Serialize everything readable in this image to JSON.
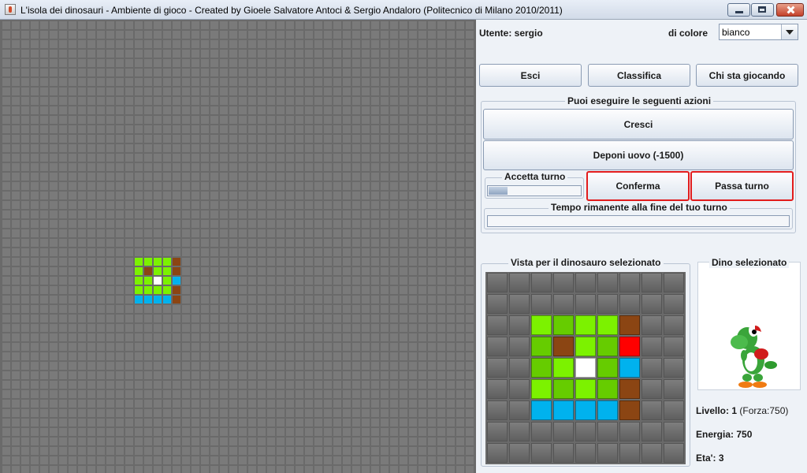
{
  "window": {
    "title": "L'isola dei dinosauri - Ambiente di gioco - Created by Gioele Salvatore Antoci & Sergio Andaloro (Politecnico di Milano 2010/2011)"
  },
  "colors": {
    "map_bg": "#6a6a6a",
    "cell_gray": "#7a7a7a",
    "green": "#7cf200",
    "green_dark": "#66cc00",
    "brown": "#8b4513",
    "cyan": "#00b2ee",
    "white": "#ffffff",
    "red": "#ff0000"
  },
  "map": {
    "cols": 50,
    "rows": 48,
    "colored_cells": [
      {
        "c": 14,
        "r": 25,
        "t": "green"
      },
      {
        "c": 15,
        "r": 25,
        "t": "green"
      },
      {
        "c": 16,
        "r": 25,
        "t": "green"
      },
      {
        "c": 17,
        "r": 25,
        "t": "green"
      },
      {
        "c": 18,
        "r": 25,
        "t": "brown"
      },
      {
        "c": 14,
        "r": 26,
        "t": "green"
      },
      {
        "c": 15,
        "r": 26,
        "t": "brown"
      },
      {
        "c": 16,
        "r": 26,
        "t": "green"
      },
      {
        "c": 17,
        "r": 26,
        "t": "green"
      },
      {
        "c": 18,
        "r": 26,
        "t": "brown"
      },
      {
        "c": 14,
        "r": 27,
        "t": "green"
      },
      {
        "c": 15,
        "r": 27,
        "t": "green"
      },
      {
        "c": 16,
        "r": 27,
        "t": "white"
      },
      {
        "c": 17,
        "r": 27,
        "t": "green"
      },
      {
        "c": 18,
        "r": 27,
        "t": "cyan"
      },
      {
        "c": 14,
        "r": 28,
        "t": "green"
      },
      {
        "c": 15,
        "r": 28,
        "t": "green"
      },
      {
        "c": 16,
        "r": 28,
        "t": "green"
      },
      {
        "c": 17,
        "r": 28,
        "t": "green"
      },
      {
        "c": 18,
        "r": 28,
        "t": "brown"
      },
      {
        "c": 14,
        "r": 29,
        "t": "cyan"
      },
      {
        "c": 15,
        "r": 29,
        "t": "cyan"
      },
      {
        "c": 16,
        "r": 29,
        "t": "cyan"
      },
      {
        "c": 17,
        "r": 29,
        "t": "cyan"
      },
      {
        "c": 18,
        "r": 29,
        "t": "brown"
      }
    ]
  },
  "header": {
    "user_label": "Utente: sergio",
    "color_label": "di colore",
    "color_value": "bianco"
  },
  "top_buttons": {
    "exit": "Esci",
    "ranking": "Classifica",
    "who_playing": "Chi sta giocando"
  },
  "actions": {
    "legend": "Puoi eseguire le seguenti azioni",
    "grow": "Cresci",
    "lay_egg": "Deponi uovo (-1500)",
    "accept_turn_label": "Accetta turno",
    "accept_progress": 0.2,
    "confirm": "Conferma",
    "pass_turn": "Passa turno",
    "time_left_label": "Tempo rimanente alla fine del tuo turno",
    "time_progress": 0.0
  },
  "view": {
    "legend": "Vista per il dinosauro selezionato",
    "cols": 9,
    "rows": 9,
    "cells": [
      [
        "g",
        "g",
        "g",
        "g",
        "g",
        "g",
        "g",
        "g",
        "g"
      ],
      [
        "g",
        "g",
        "g",
        "g",
        "g",
        "g",
        "g",
        "g",
        "g"
      ],
      [
        "g",
        "g",
        "green",
        "green_dark",
        "green",
        "green",
        "brown",
        "g",
        "g"
      ],
      [
        "g",
        "g",
        "green_dark",
        "brown",
        "green",
        "green_dark",
        "red",
        "g",
        "g"
      ],
      [
        "g",
        "g",
        "green_dark",
        "green",
        "white",
        "green_dark",
        "cyan",
        "g",
        "g"
      ],
      [
        "g",
        "g",
        "green",
        "green_dark",
        "green",
        "green_dark",
        "brown",
        "g",
        "g"
      ],
      [
        "g",
        "g",
        "cyan",
        "cyan",
        "cyan",
        "cyan",
        "brown",
        "g",
        "g"
      ],
      [
        "g",
        "g",
        "g",
        "g",
        "g",
        "g",
        "g",
        "g",
        "g"
      ],
      [
        "g",
        "g",
        "g",
        "g",
        "g",
        "g",
        "g",
        "g",
        "g"
      ]
    ]
  },
  "dino": {
    "legend": "Dino selezionato",
    "icon": "yoshi-dinosaur-icon",
    "level_prefix": "Livello: ",
    "level_value": "1",
    "level_suffix": " (Forza:750)",
    "energy": "Energia: 750",
    "age": "Eta': 3"
  }
}
